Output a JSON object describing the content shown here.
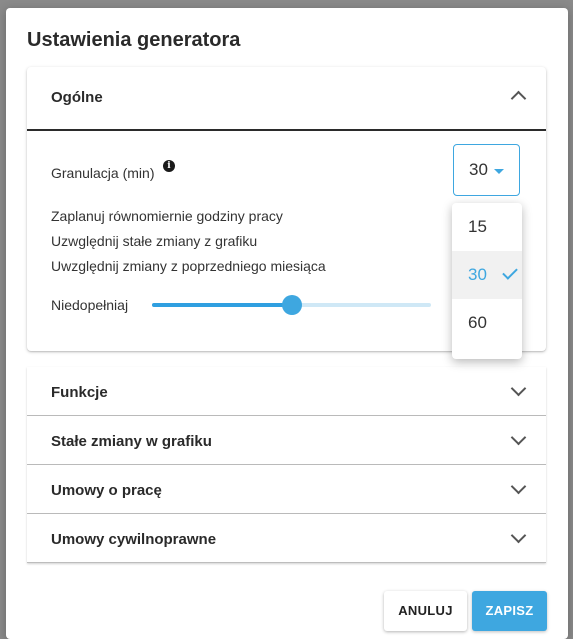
{
  "modal": {
    "title": "Ustawienia generatora"
  },
  "general": {
    "title": "Ogólne",
    "granulation_label": "Granulacja (min)",
    "info_icon": "info-icon",
    "select_value": "30",
    "options": [
      "Zaplanuj równomiernie godziny pracy",
      "Uzwględnij stałe zmiany z grafiku",
      "Uwzględnij zmiany z poprzedniego miesiąca"
    ],
    "slider_label": "Niedopełniaj",
    "slider_value_fraction": 0.5
  },
  "dropdown": {
    "items": [
      "15",
      "30",
      "60"
    ],
    "selected": "30"
  },
  "sections": [
    {
      "title": "Funkcje"
    },
    {
      "title": "Stałe zmiany w grafiku"
    },
    {
      "title": "Umowy o pracę"
    },
    {
      "title": "Umowy cywilnoprawne"
    }
  ],
  "footer": {
    "cancel_label": "ANULUJ",
    "save_label": "ZAPISZ"
  },
  "colors": {
    "accent": "#3ea7e0",
    "slider_track": "#cfe8f6"
  }
}
